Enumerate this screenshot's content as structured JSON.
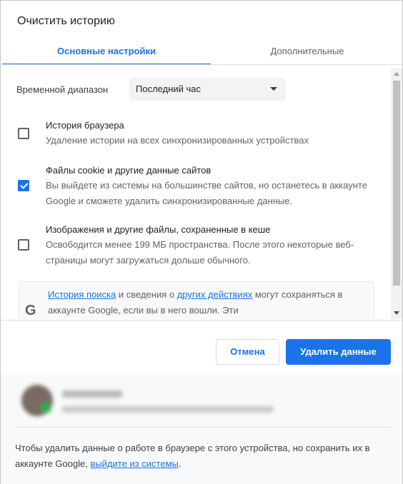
{
  "dialog": {
    "title": "Очистить историю"
  },
  "tabs": [
    {
      "label": "Основные настройки",
      "active": true
    },
    {
      "label": "Дополнительные",
      "active": false
    }
  ],
  "time_range": {
    "label": "Временной диапазон",
    "value": "Последний час"
  },
  "options": [
    {
      "title": "История браузера",
      "description": "Удаление истории на всех синхронизированных устройствах",
      "checked": false
    },
    {
      "title": "Файлы cookie и другие данные сайтов",
      "description": "Вы выйдете из системы на большинстве сайтов, но останетесь в аккаунте Google и сможете удалить синхронизированные данные.",
      "checked": true
    },
    {
      "title": "Изображения и другие файлы, сохраненные в кеше",
      "description": "Освободится менее 199 МБ пространства. После этого некоторые веб-страницы могут загружаться дольше обычного.",
      "checked": false
    }
  ],
  "notice": {
    "logo": "G",
    "link_search_history": "История поиска",
    "text_mid": " и сведения о ",
    "link_other_activity": "других действиях",
    "text_end": " могут сохраняться в аккаунте Google, если вы в него вошли. Эти"
  },
  "buttons": {
    "cancel": "Отмена",
    "delete": "Удалить данные"
  },
  "footer": {
    "text_before_link": "Чтобы удалить данные о работе в браузере с этого устройства, но сохранить их в аккаунте Google, ",
    "signout_link": "выйдите из системы",
    "text_after_link": "."
  },
  "colors": {
    "accent": "#1a73e8",
    "text_primary": "#202124",
    "text_secondary": "#5f6368"
  },
  "icons": {
    "dropdown": "caret-down-icon",
    "checkbox_checked": "check-icon",
    "google": "google-logo-icon",
    "scroll_up": "scroll-up-icon",
    "scroll_down": "scroll-down-icon"
  }
}
